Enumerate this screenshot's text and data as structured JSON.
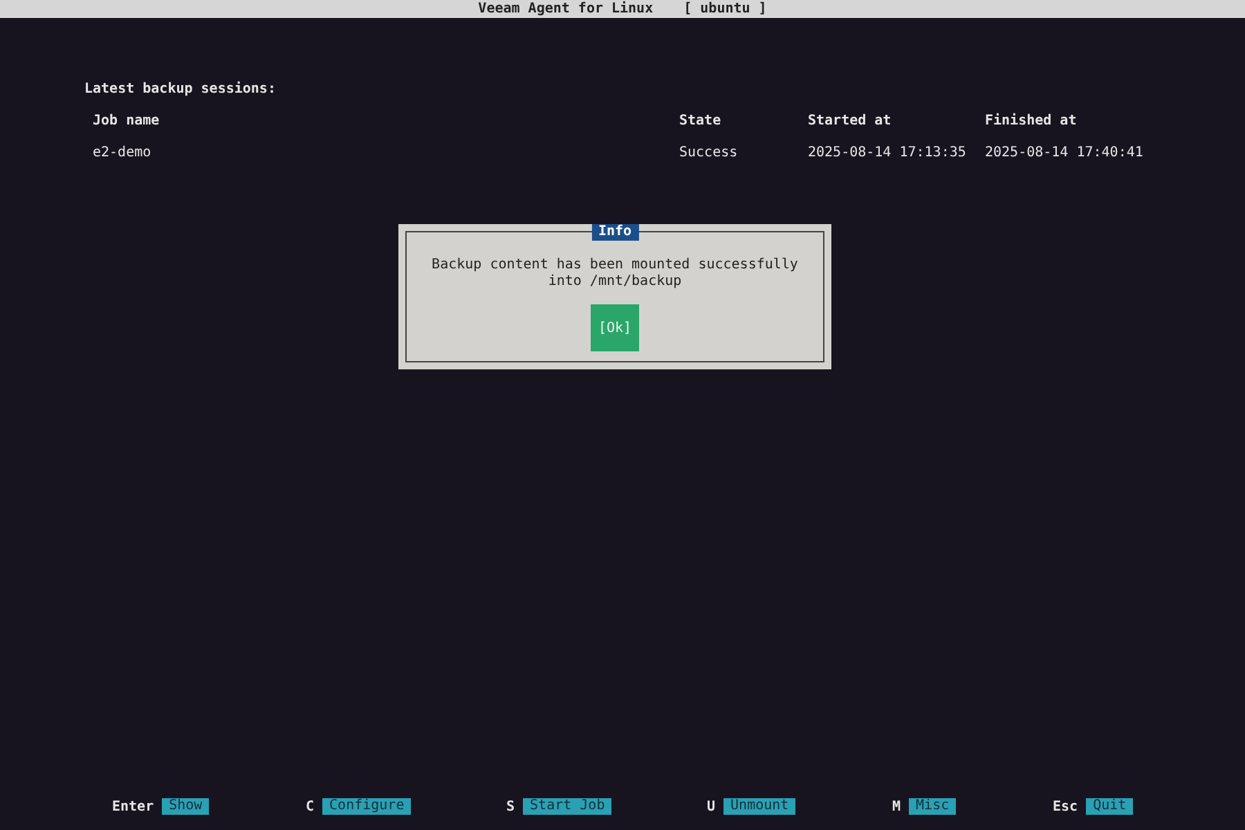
{
  "window": {
    "title": "Veeam Agent for Linux",
    "host": "[ ubuntu ]"
  },
  "sessions": {
    "heading": "Latest backup sessions:",
    "columns": [
      "Job name",
      "State",
      "Started at",
      "Finished at"
    ],
    "rows": [
      [
        "e2-demo",
        "Success",
        "2025-08-14 17:13:35",
        "2025-08-14 17:40:41"
      ]
    ]
  },
  "dialog": {
    "title": "Info",
    "message": "Backup content has been mounted successfully into /mnt/backup",
    "button": "[Ok]"
  },
  "footer": [
    {
      "key": "Enter",
      "action": "Show"
    },
    {
      "key": "C",
      "action": "Configure"
    },
    {
      "key": "S",
      "action": "Start Job"
    },
    {
      "key": "U",
      "action": "Unmount"
    },
    {
      "key": "M",
      "action": "Misc"
    },
    {
      "key": "Esc",
      "action": "Quit"
    }
  ]
}
